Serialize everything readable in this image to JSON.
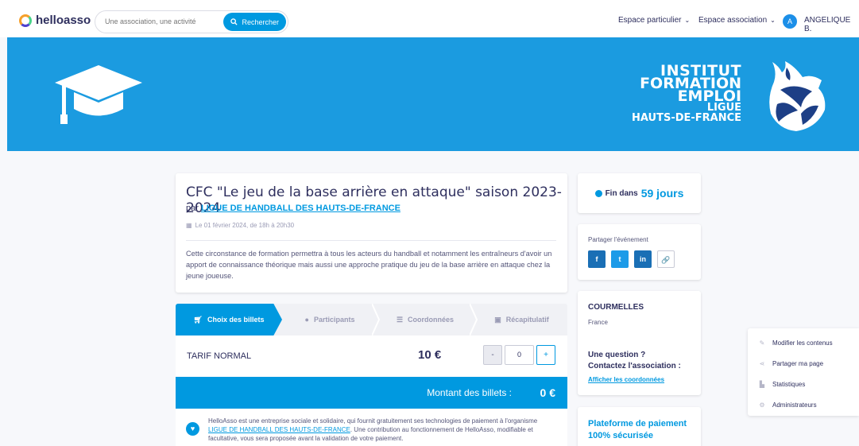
{
  "header": {
    "logo_text": "helloasso",
    "search_placeholder": "Une association, une activité",
    "search_button": "Rechercher",
    "nav_particulier": "Espace particulier",
    "nav_association": "Espace association",
    "avatar_letter": "A",
    "user_name": "ANGELIQUE B."
  },
  "banner": {
    "org_lines": [
      "INSTITUT",
      "FORMATION",
      "EMPLOI",
      "LIGUE",
      "HAUTS-DE-FRANCE"
    ]
  },
  "event": {
    "title": "CFC \"Le jeu de la base arrière en attaque\" saison 2023-2024",
    "by_prefix": "par",
    "organizer": "LIGUE DE HANDBALL DES HAUTS-DE-FRANCE",
    "date": "Le 01 février 2024, de 18h à 20h30",
    "description": "Cette circonstance de formation permettra à tous les acteurs du handball et notamment les entraîneurs d'avoir un apport de connaissance théorique mais aussi une approche pratique du jeu de la base arrière en attaque chez la jeune joueuse."
  },
  "steps": [
    {
      "label": "Choix des billets",
      "icon": "cart-icon"
    },
    {
      "label": "Participants",
      "icon": "user-icon"
    },
    {
      "label": "Coordonnées",
      "icon": "list-icon"
    },
    {
      "label": "Récapitulatif",
      "icon": "check-icon"
    }
  ],
  "ticket": {
    "name": "TARIF NORMAL",
    "price": "10 €",
    "minus": "-",
    "quantity": "0",
    "plus": "+"
  },
  "total": {
    "label": "Montant des billets :",
    "value": "0 €"
  },
  "info": {
    "text_before": "HelloAsso est une entreprise sociale et solidaire, qui fournit gratuitement ses technologies de paiement à l'organisme",
    "link": "LIGUE DE HANDBALL DES HAUTS-DE-FRANCE",
    "text_after": ". Une contribution au fonctionnement de HelloAsso, modifiable et facultative, vous sera proposée avant la validation de votre paiement."
  },
  "countdown": {
    "prefix": "Fin dans",
    "days": "59 jours"
  },
  "share": {
    "title": "Partager l'événement",
    "facebook": "f",
    "twitter": "t",
    "linkedin": "in",
    "link": "🔗"
  },
  "location": {
    "city": "COURMELLES",
    "country": "France",
    "question_1": "Une question ?",
    "question_2": "Contactez l'association :",
    "coords_link": "Afficher les coordonnées"
  },
  "platform": {
    "line_1": "Plateforme de paiement",
    "line_2": "100% sécurisée"
  },
  "admin_menu": [
    {
      "label": "Modifier les contenus",
      "icon": "pencil-icon"
    },
    {
      "label": "Partager ma page",
      "icon": "share-icon"
    },
    {
      "label": "Statistiques",
      "icon": "chart-icon"
    },
    {
      "label": "Administrateurs",
      "icon": "gear-icon"
    }
  ],
  "colors": {
    "accent": "#0099e0",
    "banner": "#1b9be0",
    "text": "#2e2f5e"
  }
}
